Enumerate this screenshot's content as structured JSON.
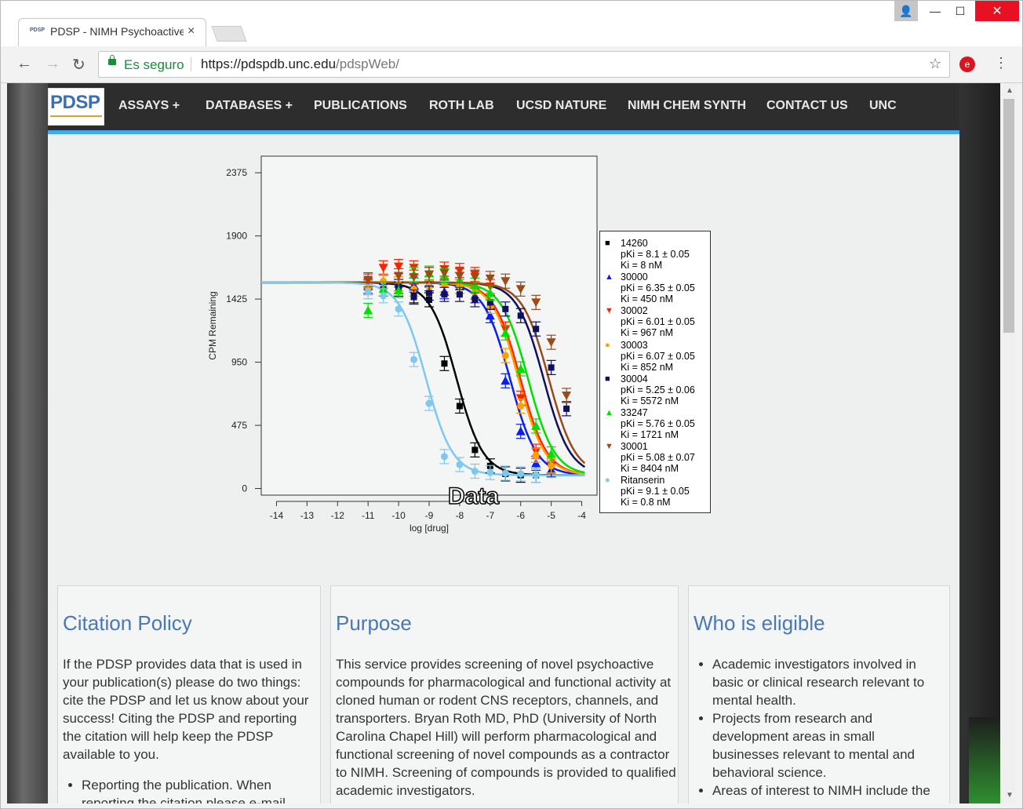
{
  "browser": {
    "tab_title": "PDSP - NIMH Psychoactive Drug Screening Program",
    "tab_favicon": "PDSP",
    "tab_close": "×",
    "secure_label": "Es seguro",
    "url_host": "https://pdspdb.unc.edu",
    "url_path": "/pdspWeb/",
    "back": "←",
    "forward": "→",
    "reload": "↻",
    "star": "☆",
    "menu": "⋮",
    "minimize": "—",
    "maximize": "☐",
    "close": "✕",
    "profile": "👤"
  },
  "nav": {
    "logo": "PDSP",
    "items": [
      "ASSAYS +",
      "DATABASES +",
      "PUBLICATIONS",
      "ROTH LAB",
      "UCSD NATURE",
      "NIMH CHEM SYNTH",
      "CONTACT US",
      "UNC"
    ]
  },
  "chart_data": {
    "type": "scatter",
    "xlabel": "log [drug]",
    "ylabel": "CPM Remaining",
    "xlim": [
      -14.5,
      -3.5
    ],
    "ylim": [
      -50,
      2500
    ],
    "xticks": [
      -14,
      -13,
      -12,
      -11,
      -10,
      -9,
      -8,
      -7,
      -6,
      -5,
      -4
    ],
    "yticks": [
      0,
      475,
      950,
      1425,
      1900,
      2375
    ],
    "watermark": "Data",
    "top": 1550,
    "bottom": 100,
    "series": [
      {
        "name": "14260",
        "pk": "pKi = 8.1 ± 0.05",
        "ki": "Ki = 8 nM",
        "color": "#000000",
        "marker": "square",
        "logec50": -8.1,
        "points": [
          [
            -10,
            1500
          ],
          [
            -9.5,
            1450
          ],
          [
            -9,
            1420
          ],
          [
            -8.5,
            940
          ],
          [
            -8,
            620
          ],
          [
            -7.5,
            290
          ],
          [
            -7,
            170
          ],
          [
            -6.5,
            110
          ],
          [
            -6,
            100
          ],
          [
            -5.5,
            100
          ]
        ]
      },
      {
        "name": "30000",
        "pk": "pKi = 6.35 ± 0.05",
        "ki": "Ki = 450 nM",
        "color": "#0a1ef0",
        "marker": "triangle",
        "logec50": -6.35,
        "points": [
          [
            -11,
            1520
          ],
          [
            -10.5,
            1560
          ],
          [
            -10,
            1540
          ],
          [
            -9.5,
            1530
          ],
          [
            -9,
            1540
          ],
          [
            -8.5,
            1480
          ],
          [
            -8,
            1520
          ],
          [
            -7.5,
            1450
          ],
          [
            -7,
            1300
          ],
          [
            -6.5,
            810
          ],
          [
            -6,
            430
          ],
          [
            -5.5,
            190
          ],
          [
            -5,
            140
          ]
        ]
      },
      {
        "name": "30002",
        "pk": "pKi = 6.01 ± 0.05",
        "ki": "Ki = 967 nM",
        "color": "#ff2000",
        "marker": "triangle-down",
        "logec50": -6.01,
        "points": [
          [
            -11,
            1560
          ],
          [
            -10.5,
            1660
          ],
          [
            -10,
            1670
          ],
          [
            -9.5,
            1660
          ],
          [
            -9,
            1610
          ],
          [
            -8.5,
            1650
          ],
          [
            -8,
            1640
          ],
          [
            -7.5,
            1610
          ],
          [
            -7,
            1520
          ],
          [
            -6.5,
            1200
          ],
          [
            -6,
            680
          ],
          [
            -5.5,
            280
          ],
          [
            -5,
            170
          ]
        ]
      },
      {
        "name": "30003",
        "pk": "pKi = 6.07 ± 0.05",
        "ki": "Ki = 852 nM",
        "color": "#ffa000",
        "marker": "circle",
        "logec50": -6.07,
        "points": [
          [
            -11,
            1510
          ],
          [
            -10.5,
            1560
          ],
          [
            -10,
            1540
          ],
          [
            -9.5,
            1500
          ],
          [
            -9,
            1520
          ],
          [
            -8.5,
            1530
          ],
          [
            -8,
            1520
          ],
          [
            -7.5,
            1480
          ],
          [
            -7,
            1370
          ],
          [
            -6.5,
            1000
          ],
          [
            -6,
            620
          ],
          [
            -5.5,
            250
          ],
          [
            -5,
            170
          ]
        ]
      },
      {
        "name": "30004",
        "pk": "pKi = 5.25 ± 0.06",
        "ki": "Ki = 5572 nM",
        "color": "#101060",
        "marker": "square",
        "logec50": -5.25,
        "points": [
          [
            -10.5,
            1500
          ],
          [
            -10,
            1520
          ],
          [
            -9.5,
            1440
          ],
          [
            -9,
            1470
          ],
          [
            -8.5,
            1460
          ],
          [
            -8,
            1460
          ],
          [
            -7.5,
            1420
          ],
          [
            -7,
            1400
          ],
          [
            -6.5,
            1350
          ],
          [
            -6,
            1300
          ],
          [
            -5.5,
            1200
          ],
          [
            -5,
            910
          ],
          [
            -4.5,
            600
          ]
        ]
      },
      {
        "name": "33247",
        "pk": "pKi = 5.76 ± 0.05",
        "ki": "Ki = 1721 nM",
        "color": "#00e000",
        "marker": "triangle",
        "logec50": -5.76,
        "points": [
          [
            -11,
            1340
          ],
          [
            -10.5,
            1500
          ],
          [
            -10,
            1490
          ],
          [
            -9.5,
            1610
          ],
          [
            -9,
            1620
          ],
          [
            -8.5,
            1600
          ],
          [
            -8,
            1570
          ],
          [
            -7.5,
            1530
          ],
          [
            -7,
            1470
          ],
          [
            -6.5,
            1170
          ],
          [
            -6,
            900
          ],
          [
            -5.5,
            470
          ],
          [
            -5,
            260
          ]
        ]
      },
      {
        "name": "30001",
        "pk": "pKi = 5.08 ± 0.07",
        "ki": "Ki = 8404 nM",
        "color": "#9b4a1a",
        "marker": "triangle-down",
        "logec50": -5.08,
        "points": [
          [
            -11,
            1570
          ],
          [
            -10,
            1600
          ],
          [
            -9.5,
            1590
          ],
          [
            -9,
            1610
          ],
          [
            -8.5,
            1620
          ],
          [
            -8,
            1600
          ],
          [
            -7.5,
            1590
          ],
          [
            -7,
            1580
          ],
          [
            -6.5,
            1560
          ],
          [
            -6,
            1500
          ],
          [
            -5.5,
            1400
          ],
          [
            -5,
            1100
          ],
          [
            -4.5,
            700
          ]
        ]
      },
      {
        "name": "Ritanserin",
        "pk": "pKi = 9.1 ± 0.05",
        "ki": "Ki = 0.8 nM",
        "color": "#7ec8f0",
        "marker": "circle",
        "logec50": -9.1,
        "points": [
          [
            -11,
            1480
          ],
          [
            -10.5,
            1450
          ],
          [
            -10,
            1350
          ],
          [
            -9.5,
            970
          ],
          [
            -9,
            640
          ],
          [
            -8.5,
            240
          ],
          [
            -8,
            180
          ],
          [
            -7.5,
            130
          ],
          [
            -7,
            120
          ],
          [
            -6.5,
            115
          ],
          [
            -6,
            110
          ],
          [
            -5.5,
            100
          ]
        ]
      }
    ]
  },
  "cards": [
    {
      "title": "Citation Policy",
      "paragraph": "If the PDSP provides data that is used in your publication(s) please do two things: cite the PDSP and let us know about your success! Citing the PDSP and reporting the citation will help keep the PDSP available to you.",
      "bullets": [
        "Reporting the publication. When reporting the citation please e-mail"
      ]
    },
    {
      "title": "Purpose",
      "paragraph": "This service provides screening of novel psychoactive compounds for pharmacological and functional activity at cloned human or rodent CNS receptors, channels, and transporters. Bryan Roth MD, PhD (University of North Carolina Chapel Hill) will perform pharmacological and functional screening of novel compounds as a contractor to NIMH. Screening of compounds is provided to qualified academic investigators.",
      "bullets": []
    },
    {
      "title": "Who is eligible",
      "paragraph": "",
      "bullets": [
        "Academic investigators involved in basic or clinical research relevant to mental health.",
        "Projects from research and development areas in small businesses relevant to mental and behavioral science.",
        "Areas of interest to NIMH include the design and development of"
      ]
    }
  ],
  "scrollbar": {
    "up": "▲",
    "down": "▼"
  }
}
